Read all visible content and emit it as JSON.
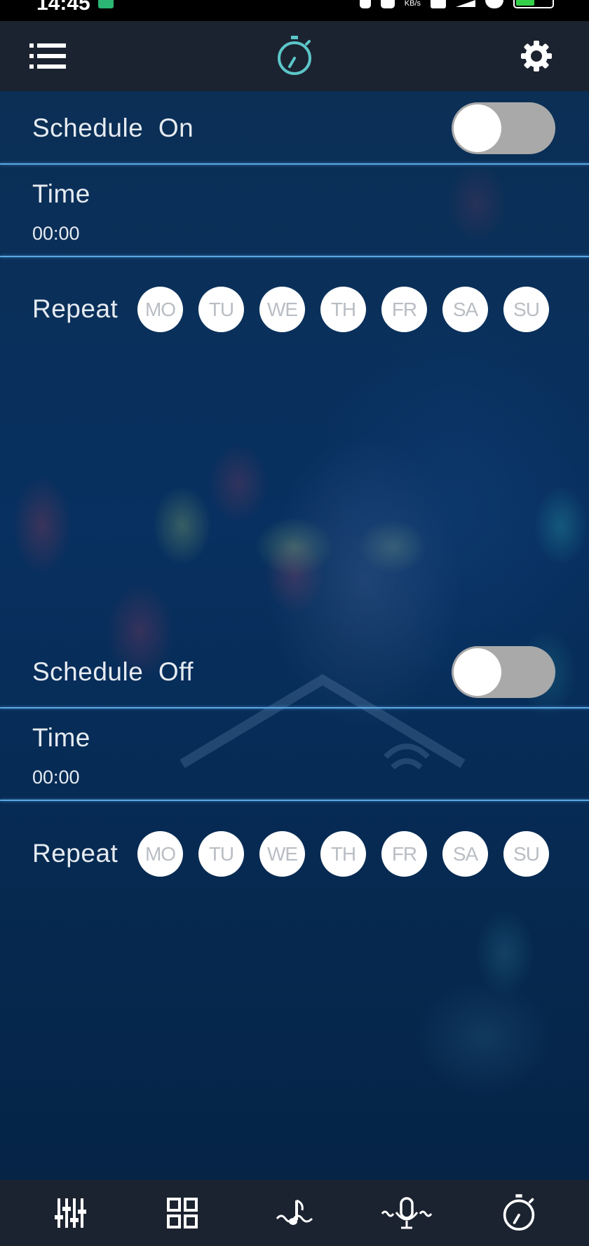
{
  "status_bar": {
    "time": "14:45",
    "network_speed_unit": "KB/s"
  },
  "header": {
    "icons": [
      "list-menu-icon",
      "timer-icon",
      "gear-icon"
    ],
    "active_icon_color": "#5cc6c9"
  },
  "schedule_on": {
    "title": "Schedule  On",
    "enabled": false,
    "time_label": "Time",
    "time_value": "00:00",
    "repeat_label": "Repeat",
    "days": [
      "MO",
      "TU",
      "WE",
      "TH",
      "FR",
      "SA",
      "SU"
    ]
  },
  "schedule_off": {
    "title": "Schedule  Off",
    "enabled": false,
    "time_label": "Time",
    "time_value": "00:00",
    "repeat_label": "Repeat",
    "days": [
      "MO",
      "TU",
      "WE",
      "TH",
      "FR",
      "SA",
      "SU"
    ]
  },
  "tab_bar": {
    "tabs": [
      "equalizer-icon",
      "grid-icon",
      "music-wave-icon",
      "microphone-wave-icon",
      "timer-icon"
    ]
  },
  "colors": {
    "divider": "#5aa8e6",
    "toggle_off": "#a9a9a9",
    "bar_background": "#1c2330"
  }
}
